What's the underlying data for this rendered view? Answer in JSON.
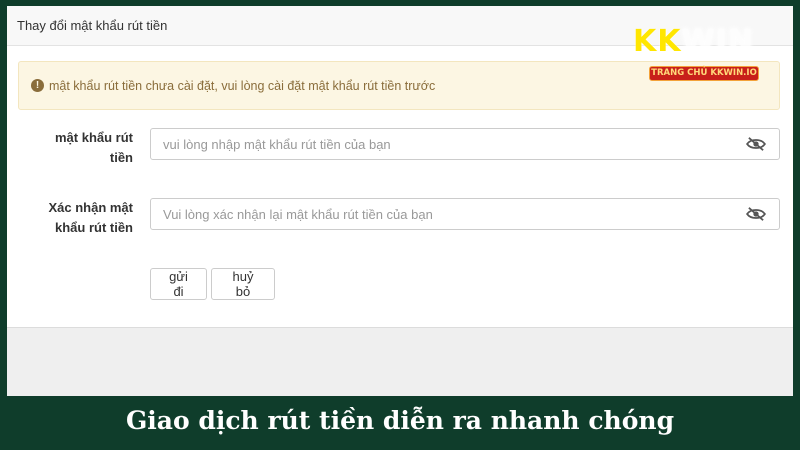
{
  "panel": {
    "title": "Thay đổi mật khẩu rút tiền"
  },
  "alert": {
    "icon": "exclamation-circle-icon",
    "message": "mật khẩu rút tiền chưa cài đặt, vui lòng cài đặt mật khẩu rút tiền trước"
  },
  "form": {
    "password": {
      "label_line1": "mật khẩu rút",
      "label_line2": "tiền",
      "placeholder": "vui lòng nhập mật khẩu rút tiền của bạn",
      "icon": "eye-slash-icon"
    },
    "confirm": {
      "label_line1": "Xác nhận mật",
      "label_line2": "khẩu rút tiền",
      "placeholder": "Vui lòng xác nhận lại mật khẩu rút tiền của bạn",
      "icon": "eye-slash-icon"
    }
  },
  "buttons": {
    "submit": "gửi đi",
    "cancel": "huỷ bỏ"
  },
  "logo": {
    "brand": "KK",
    "suffix": "WIN",
    "badge": "TRANG CHỦ KKWIN.IO"
  },
  "caption": "Giao dịch rút tiền diễn ra nhanh chóng",
  "colors": {
    "background": "#0f3d2b",
    "alert_bg": "#fcf6e3",
    "alert_text": "#8a6d3b",
    "caption": "#ffffff"
  }
}
